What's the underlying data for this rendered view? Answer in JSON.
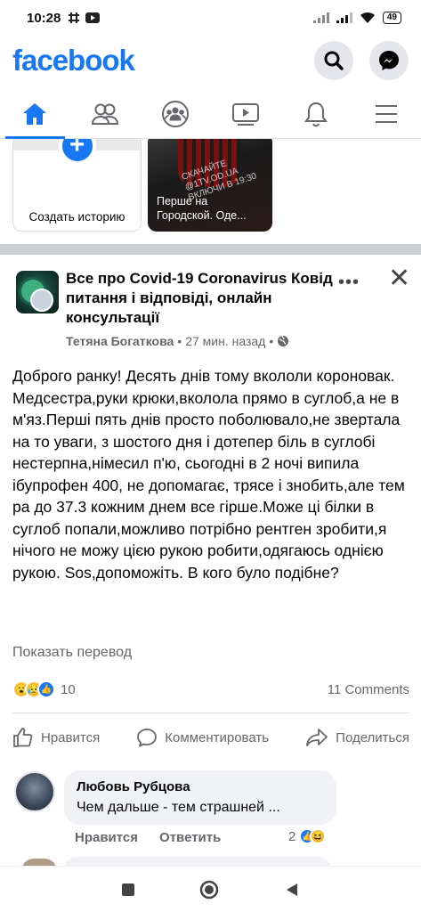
{
  "status_bar": {
    "time": "10:28",
    "battery": "49"
  },
  "header": {
    "logo": "facebook",
    "search_icon": "search-icon",
    "messenger_icon": "messenger-icon",
    "brand_color": "#1877f2"
  },
  "nav_tabs": [
    {
      "name": "home",
      "icon": "home-icon",
      "active": true
    },
    {
      "name": "friends",
      "icon": "friends-icon",
      "active": false
    },
    {
      "name": "groups",
      "icon": "groups-icon",
      "active": false
    },
    {
      "name": "watch",
      "icon": "watch-icon",
      "active": false
    },
    {
      "name": "notifications",
      "icon": "bell-icon",
      "active": false
    },
    {
      "name": "menu",
      "icon": "menu-icon",
      "active": false
    }
  ],
  "stories": {
    "create_label": "Создать историю",
    "user_story": {
      "watermark": "СКАЧАЙТЕ @1TV.OD.UA\nВКЛЮЧИ В 19:30",
      "caption": "Перше на\nГородской. Оде..."
    }
  },
  "post": {
    "group_name": "Все про Covid-19 Coronavirus Ковід питання і відповіді, онлайн консультації",
    "author": "Тетяна Богаткова",
    "time": "27 мин. назад",
    "body": "Доброго ранку! Десять днів тому вкололи короновак. Медсестра,руки крюки,вколола прямо в суглоб,а не в м'яз.Перші пять днів просто поболювало,не звертала на то уваги, з шостого дня і дотепер біль в суглобі нестерпна,німесил п'ю, сьогодні в 2 ночі випила ібупрофен 400, не допомагає, трясе і знобить,але тем ра до 37.3 кожним днем все гірше.Може ці білки в суглоб попали,можливо потрібно рентген зробити,я нічого не можу цією рукою робити,одягаюсь однією рукою. Sos,допоможіть. В кого було подібне?",
    "translate_label": "Показать перевод",
    "reaction_count": "10",
    "comments_count": "11 Comments",
    "actions": {
      "like": "Нравится",
      "comment": "Комментировать",
      "share": "Поделиться"
    }
  },
  "comment": {
    "author": "Любовь Рубцова",
    "text": "Чем дальше - тем страшней ...",
    "like_label": "Нравится",
    "reply_label": "Ответить",
    "reaction_count": "2"
  }
}
